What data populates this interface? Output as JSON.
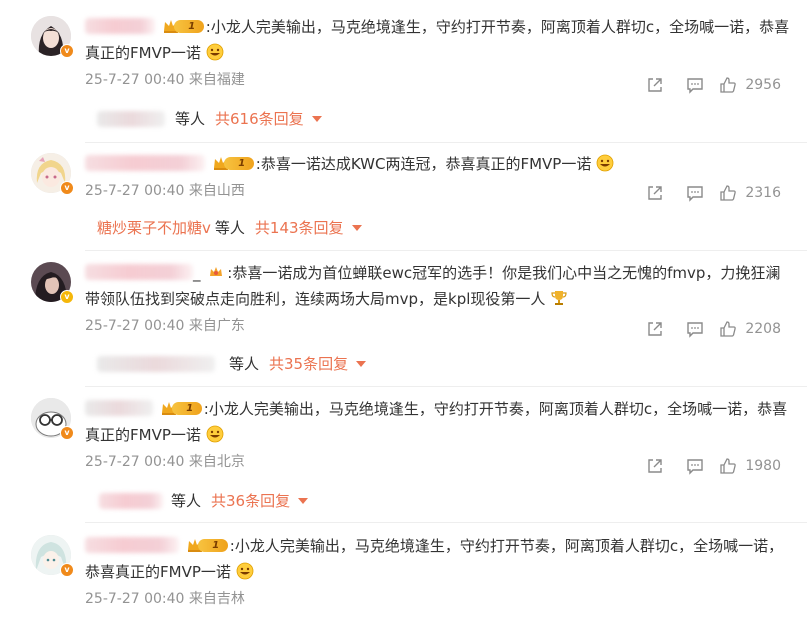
{
  "comments": [
    {
      "text": ":小龙人完美输出，马克绝境逢生，守约打开节奏，阿离顶着人群切c，全场喊一诺，恭喜真正的FMVP一诺",
      "time": "25-7-27 00:40",
      "location": "来自福建",
      "likes": "2956",
      "level": "1",
      "reply_prefix": "",
      "reply_mid": "等人",
      "reply_count": "共616条回复",
      "avatar_icon": "avatar-girl-dark-hair",
      "verify_icon": "v-badge-orange"
    },
    {
      "text": ":恭喜一诺达成KWC两连冠，恭喜真正的FMVP一诺",
      "time": "25-7-27 00:40",
      "location": "来自山西",
      "likes": "2316",
      "level": "1",
      "reply_prefix": "糖炒栗子不加糖v",
      "reply_mid": "等人",
      "reply_count": "共143条回复",
      "avatar_icon": "avatar-anime-blonde",
      "verify_icon": "v-badge-orange"
    },
    {
      "text": ":恭喜一诺成为首位蝉联ewc冠军的选手！你是我们心中当之无愧的fmvp，力挽狂澜带领队伍找到突破点走向胜利，连续两场大局mvp，是kpl现役第一人",
      "time": "25-7-27 00:40",
      "location": "来自广东",
      "likes": "2208",
      "level": "",
      "reply_prefix": "",
      "reply_mid": "等人",
      "reply_count": "共35条回复",
      "avatar_icon": "avatar-dark-girl",
      "verify_icon": "v-badge-gold"
    },
    {
      "text": ":小龙人完美输出，马克绝境逢生，守约打开节奏，阿离顶着人群切c，全场喊一诺，恭喜真正的FMVP一诺",
      "time": "25-7-27 00:40",
      "location": "来自北京",
      "likes": "1980",
      "level": "1",
      "reply_prefix": "",
      "reply_mid": "等人",
      "reply_count": "共36条回复",
      "avatar_icon": "avatar-cartoon-glasses",
      "verify_icon": "v-badge-orange"
    },
    {
      "text": ":小龙人完美输出，马克绝境逢生，守约打开节奏，阿离顶着人群切c，全场喊一诺，恭喜真正的FMVP一诺",
      "time": "25-7-27 00:40",
      "location": "来自吉林",
      "likes": "",
      "level": "1",
      "reply_prefix": "",
      "reply_mid": "",
      "reply_count": "",
      "avatar_icon": "avatar-anime-white-hair",
      "verify_icon": "v-badge-orange"
    }
  ],
  "icons": {
    "share": "share-icon",
    "comment": "comment-icon",
    "like": "thumbs-up-icon",
    "emoji_grin": "grin-emoji-icon",
    "emoji_trophy": "trophy-icon",
    "crown": "crown-icon"
  },
  "colors": {
    "accent": "#eb7350",
    "meta": "#939393",
    "level_gold": "#f5b70a"
  }
}
